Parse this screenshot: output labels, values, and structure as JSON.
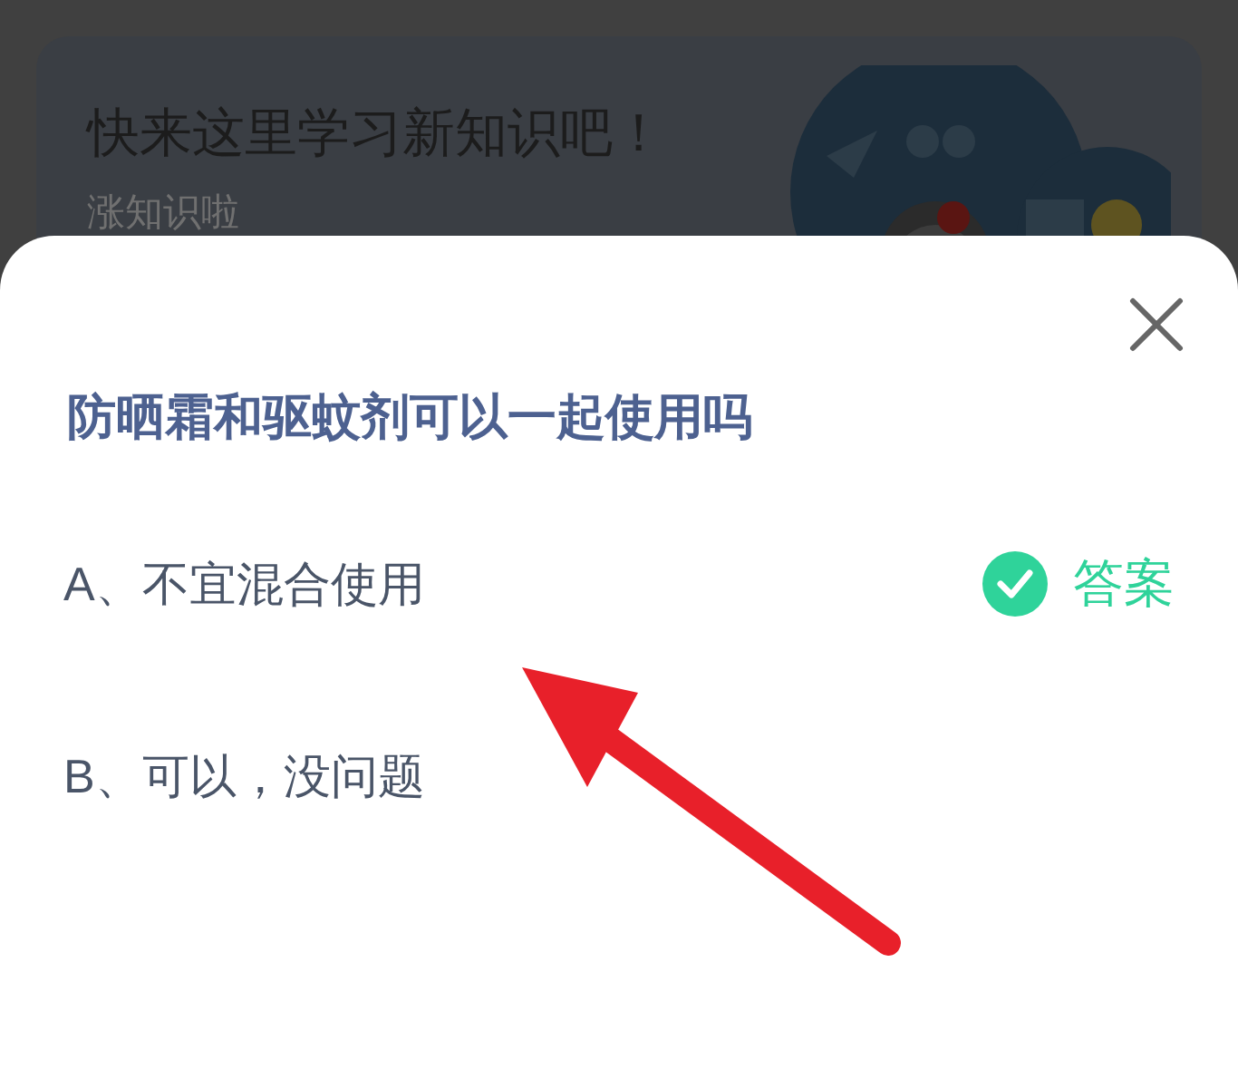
{
  "banner": {
    "title": "快来这里学习新知识吧！",
    "subtitle": "涨知识啦"
  },
  "question": {
    "text": "防晒霜和驱蚊剂可以一起使用吗",
    "answer_label": "答案",
    "options": [
      {
        "text": "A、不宜混合使用",
        "correct": true
      },
      {
        "text": "B、可以，没问题",
        "correct": false
      }
    ]
  }
}
